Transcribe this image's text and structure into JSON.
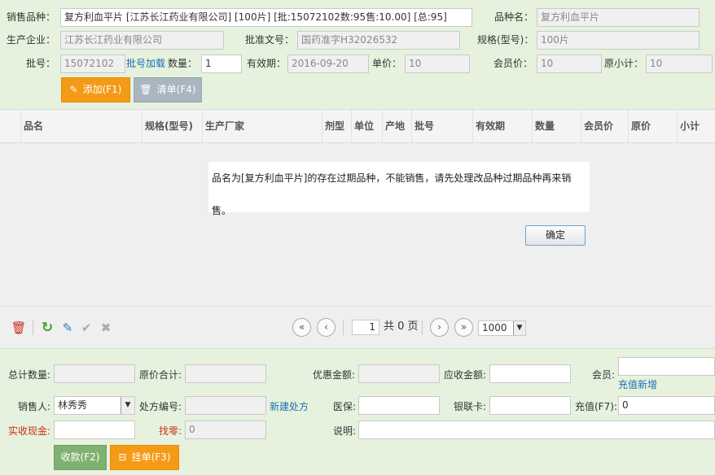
{
  "form": {
    "product_label": "销售品种：",
    "product_value": "复方利血平片 [江苏长江药业有限公司] [100片] [批:15072102数:95售:10.00] [总:95]",
    "name_label": "品种名：",
    "name_value": "复方利血平片",
    "maker_label": "生产企业：",
    "maker_value": "江苏长江药业有限公司",
    "approval_label": "批准文号：",
    "approval_value": "国药准字H32026532",
    "spec_label": "规格(型号)：",
    "spec_value": "100片",
    "batch_label": "批号：",
    "batch_value": "15072102",
    "batch_link": "批号加载",
    "qty_label": "数量：",
    "qty_value": "1",
    "expiry_label": "有效期：",
    "expiry_value": "2016-09-20",
    "price_label": "单价：",
    "price_value": "10",
    "member_price_label": "会员价：",
    "member_price_value": "10",
    "subtotal_label": "原小计：",
    "subtotal_value": "10",
    "add_button": "添加(F1)",
    "clear_button": "清单(F4)"
  },
  "grid": {
    "columns": [
      "品名",
      "规格(型号)",
      "生产厂家",
      "剂型",
      "单位",
      "产地",
      "批号",
      "有效期",
      "数量",
      "会员价",
      "原价",
      "小计"
    ]
  },
  "dialog": {
    "message": "品名为[复方利血平片]的存在过期品种，不能销售，请先处理改品种过期品种再来销售。",
    "ok": "确定"
  },
  "pager": {
    "page": "1",
    "total": "共 0 页",
    "page_size": "1000"
  },
  "footer": {
    "total_qty_label": "总计数量:",
    "total_qty_value": "",
    "orig_total_label": "原价合计:",
    "orig_total_value": "",
    "discount_label": "优惠金额:",
    "discount_value": "",
    "receivable_label": "应收金额:",
    "receivable_value": "",
    "member_label": "会员:",
    "member_value": "",
    "recharge_link": "充值新增",
    "seller_label": "销售人:",
    "seller_value": "林秀秀",
    "rx_label": "处方编号:",
    "rx_value": "",
    "new_rx_link": "新建处方",
    "insurance_label": "医保:",
    "insurance_value": "",
    "unionpay_label": "银联卡:",
    "unionpay_value": "",
    "recharge_label": "充值(F7):",
    "recharge_value": "0",
    "cash_label": "实收现金:",
    "cash_value": "",
    "change_label": "找零:",
    "change_value": "0",
    "note_label": "说明:",
    "note_value": "",
    "checkout_button": "收款(F2)",
    "hold_button": "挂单(F3)"
  },
  "colors": {
    "accent_orange": "#f49a16",
    "accent_green": "#7fb270",
    "link_blue": "#1a6fb5",
    "warn_red": "#c8301e"
  }
}
